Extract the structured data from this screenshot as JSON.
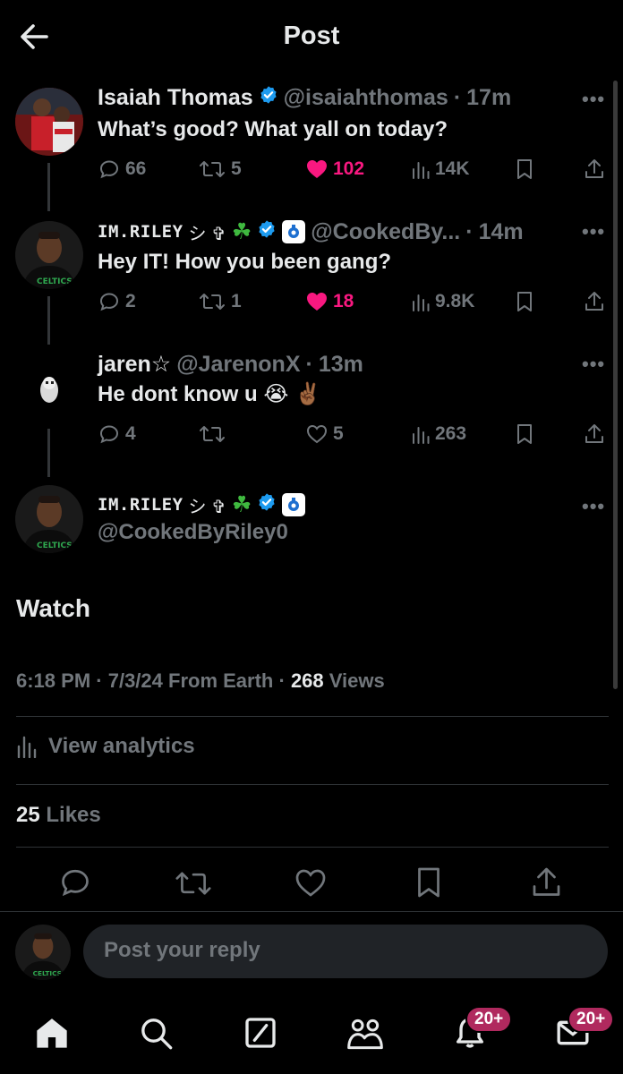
{
  "header": {
    "title": "Post"
  },
  "tweets": [
    {
      "name": "Isaiah Thomas",
      "handle": "@isaiahthomas",
      "dot": "·",
      "time": "17m",
      "text": "What’s good? What yall on today?",
      "replies": "66",
      "retweets": "5",
      "likes": "102",
      "views": "14K",
      "liked": true
    },
    {
      "name": "IM.RILEY",
      "name_glyphs": "シ ✞",
      "handle": "@CookedBy...",
      "dot": "·",
      "time": "14m",
      "text": "Hey IT! How you been gang?",
      "replies": "2",
      "retweets": "1",
      "likes": "18",
      "views": "9.8K",
      "liked": true
    },
    {
      "name": "jaren",
      "name_star": "☆",
      "handle": "@JarenonX",
      "dot": "·",
      "time": "13m",
      "text": "He dont know u",
      "emojis": "😭 ✌🏾",
      "replies": "4",
      "retweets": "",
      "likes": "5",
      "views": "263",
      "liked": false
    }
  ],
  "main_post": {
    "name": "IM.RILEY",
    "name_glyphs": "シ ✞",
    "handle": "@CookedByRiley0",
    "text": "Watch",
    "time": "6:18 PM",
    "date": "7/3/24",
    "source": "From Earth",
    "views_count": "268",
    "views_label": "Views",
    "analytics_label": "View analytics",
    "likes_count": "25",
    "likes_label": "Likes"
  },
  "reply": {
    "placeholder": "Post your reply"
  },
  "tabbar": {
    "notifications_badge": "20+",
    "messages_badge": "20+"
  },
  "colors": {
    "like": "#f91880",
    "verified": "#1d9bf0",
    "muted": "#71767b",
    "bg": "#000000"
  }
}
